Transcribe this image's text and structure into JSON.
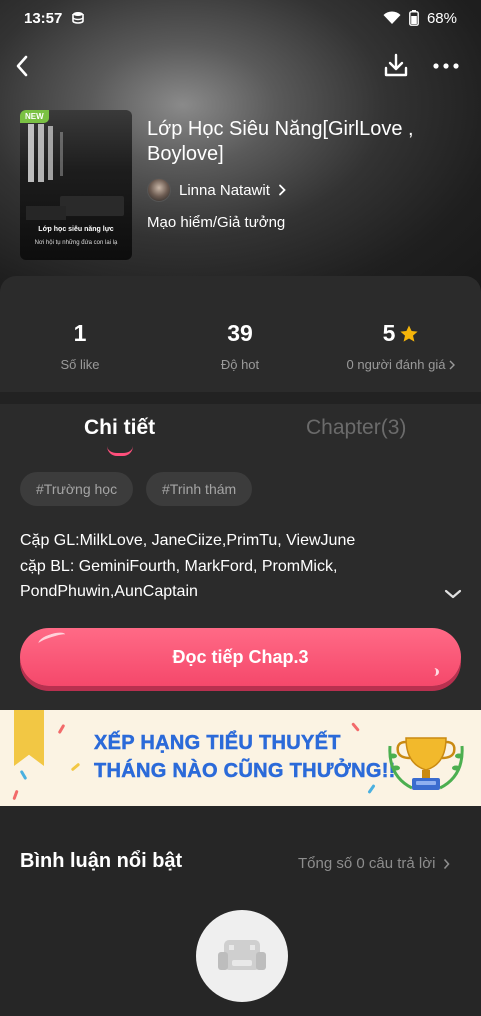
{
  "status_bar": {
    "time": "13:57",
    "battery": "68%"
  },
  "book": {
    "title": "Lớp Học Siêu Năng[GirlLove , Boylove]",
    "author": "Linna Natawit",
    "genre": "Mạo hiểm/Giả tưởng",
    "cover": {
      "badge": "NEW",
      "title": "Lớp học siêu năng lực",
      "subtitle": "Nơi hội tụ những đứa con lai lạ"
    }
  },
  "stats": [
    {
      "value": "1",
      "label": "Số like"
    },
    {
      "value": "39",
      "label": "Độ hot"
    },
    {
      "value": "5",
      "label": "0 người đánh giá"
    }
  ],
  "tabs": {
    "detail": "Chi tiết",
    "chapter": "Chapter(3)"
  },
  "tags": [
    "#Trường học",
    "#Trinh thám"
  ],
  "description": {
    "line1": "Cặp GL:MilkLove, JaneCiize,PrimTu, ViewJune",
    "line2": "cặp BL: GeminiFourth, MarkFord, PromMick,",
    "line3": "PondPhuwin,AunCaptain"
  },
  "read_button": "Đọc tiếp Chap.3",
  "banner": {
    "line1": "XẾP HẠNG TIỂU THUYẾT",
    "line2": "THÁNG NÀO CŨNG THƯỞNG!!"
  },
  "comments": {
    "title": "Bình luận nổi bật",
    "count": "Tổng số 0 câu trả lời"
  },
  "colors": {
    "accent": "#f5486b",
    "star": "#f5b50a",
    "banner_text": "#2b6ad9"
  }
}
